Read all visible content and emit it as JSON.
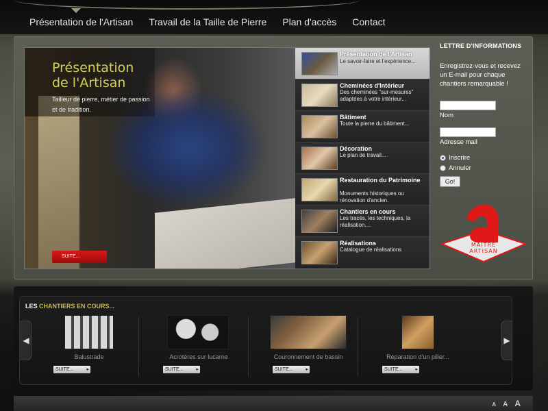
{
  "nav": {
    "items": [
      "Présentation de l'Artisan",
      "Travail de la Taille de Pierre",
      "Plan d'accès",
      "Contact"
    ]
  },
  "slider": {
    "title": "Présentation de l'Artisan",
    "description": "Tailleur de pierre, métier de passion et de tradition.",
    "button": "SUITE...",
    "items": [
      {
        "title": "Présentation de l'Artisan",
        "desc": "Le savoir-faire et l'expérience..."
      },
      {
        "title": "Cheminées d'Intérieur",
        "desc": "Des cheminées \"sur-mesures\" adaptées à votre intérieur..."
      },
      {
        "title": "Bâtiment",
        "desc": "Toute la pierre du bâtiment..."
      },
      {
        "title": "Décoration",
        "desc": "Le plan de travail..."
      },
      {
        "title": "Restauration du Patrimoine",
        "desc": "Monuments historiques ou rénovation d'ancien."
      },
      {
        "title": "Chantiers en cours",
        "desc": "Les tracés, les techniques, la réalisation...."
      },
      {
        "title": "Réalisations",
        "desc": "Catalogue de réalisations"
      }
    ]
  },
  "newsletter": {
    "heading_prefix": "LETTRE",
    "heading_rest": " D'INFORMATIONS",
    "intro": "Enregistrez-vous et recevez un E-mail pour chaque chantiers remarquable !",
    "name_label": "Nom",
    "email_label": "Adresse mail",
    "option_subscribe": "Inscrire",
    "option_cancel": "Annuler",
    "go_button": "Go!"
  },
  "logo": {
    "line1": "MAITRE",
    "line2": "ARTISAN"
  },
  "chantiers": {
    "heading_prefix": "LES ",
    "heading_rest": "CHANTIERS EN COURS...",
    "button": "SUITE...",
    "items": [
      {
        "label": "Balustrade"
      },
      {
        "label": "Acrotères sur lucarne"
      },
      {
        "label": "Couronnement de bassin"
      },
      {
        "label": "Réparation d'un pilier..."
      }
    ]
  },
  "footer": {
    "font_sizes": [
      "A",
      "A",
      "A"
    ]
  },
  "colors": {
    "accent_yellow": "#d4d05a",
    "button_red": "#c01010",
    "logo_red": "#e01818"
  }
}
